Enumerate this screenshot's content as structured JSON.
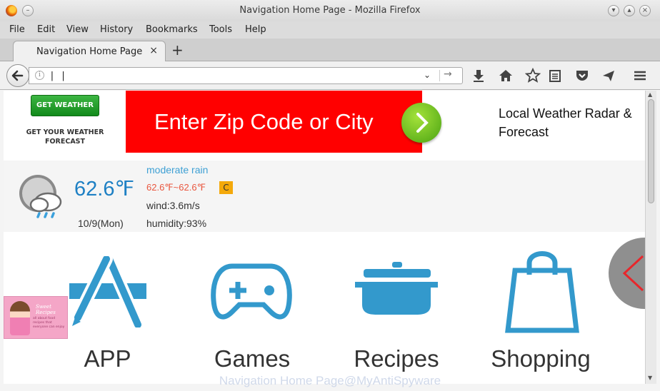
{
  "window": {
    "title": "Navigation Home Page - Mozilla Firefox",
    "controls": [
      "minimize",
      "maximize",
      "close"
    ]
  },
  "menu": [
    "File",
    "Edit",
    "View",
    "History",
    "Bookmarks",
    "Tools",
    "Help"
  ],
  "tabs": [
    {
      "label": "Navigation Home Page",
      "close": "×"
    }
  ],
  "new_tab": "+",
  "urlbar": {
    "value": "| |",
    "info_glyph": "i"
  },
  "toolbar_icons": [
    "download-icon",
    "home-icon",
    "bookmark-star-icon",
    "reading-list-icon",
    "pocket-icon",
    "send-icon",
    "menu-icon"
  ],
  "page": {
    "weather_button": "GET WEATHER",
    "weather_sub": "GET YOUR WEATHER FORECAST",
    "banner_text": "Enter Zip Code or City",
    "banner_right_line1": "Local Weather Radar &",
    "banner_right_line2": "Forecast",
    "weather": {
      "temperature": "62.6℉",
      "date": "10/9(Mon)",
      "condition": "moderate rain",
      "range": "62.6℉~62.6℉",
      "unit_toggle": "C",
      "wind": "wind:3.6m/s",
      "humidity": "humidity:93%"
    },
    "tiles": [
      {
        "label": "APP",
        "icon": "app-store-icon"
      },
      {
        "label": "Games",
        "icon": "gamepad-icon"
      },
      {
        "label": "Recipes",
        "icon": "cooking-pot-icon"
      },
      {
        "label": "Shopping",
        "icon": "shopping-bag-icon"
      }
    ],
    "ad_thumb": {
      "title": "Sweet Recipes",
      "text": "all about food recipes that everyone can enjoy"
    }
  },
  "watermark": "Navigation Home Page@MyAntiSpyware",
  "colors": {
    "accent_blue": "#3399cc",
    "banner_red": "#ff0000",
    "button_green": "#1f9a27",
    "temp_blue": "#1e80c4"
  }
}
